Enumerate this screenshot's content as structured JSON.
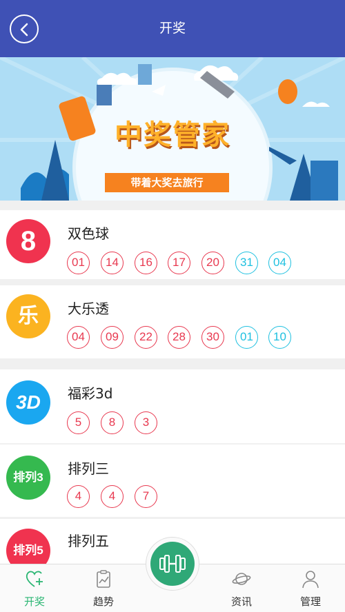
{
  "header": {
    "title": "开奖"
  },
  "banner": {
    "title": "中奖管家",
    "slogan": "带着大奖去旅行"
  },
  "lotteries": [
    {
      "name": "双色球",
      "icon_text": "8",
      "icon_color": "#f0334f",
      "red": [
        "01",
        "14",
        "16",
        "17",
        "20"
      ],
      "blue": [
        "31",
        "04"
      ]
    },
    {
      "name": "大乐透",
      "icon_text": "乐",
      "icon_color": "#fbb320",
      "red": [
        "04",
        "09",
        "22",
        "28",
        "30"
      ],
      "blue": [
        "01",
        "10"
      ]
    },
    {
      "name": "福彩3d",
      "icon_text": "3D",
      "icon_color": "#1aa7f0",
      "red": [
        "5",
        "8",
        "3"
      ],
      "blue": []
    },
    {
      "name": "排列三",
      "icon_text": "排列3",
      "icon_color": "#35b94f",
      "red": [
        "4",
        "4",
        "7"
      ],
      "blue": []
    },
    {
      "name": "排列五",
      "icon_text": "排列5",
      "icon_color": "#f0334f",
      "red": [],
      "blue": []
    }
  ],
  "tabs": [
    {
      "label": "开奖",
      "icon": "heart-plus-icon",
      "active": true
    },
    {
      "label": "趋势",
      "icon": "trend-clipboard-icon",
      "active": false
    },
    {
      "label": "资讯",
      "icon": "planet-icon",
      "active": false
    },
    {
      "label": "管理",
      "icon": "person-icon",
      "active": false
    }
  ],
  "colors": {
    "header": "#3f51b5",
    "red_ball": "#e8384f",
    "blue_ball": "#1ec0e0",
    "active_tab": "#2bb673"
  }
}
